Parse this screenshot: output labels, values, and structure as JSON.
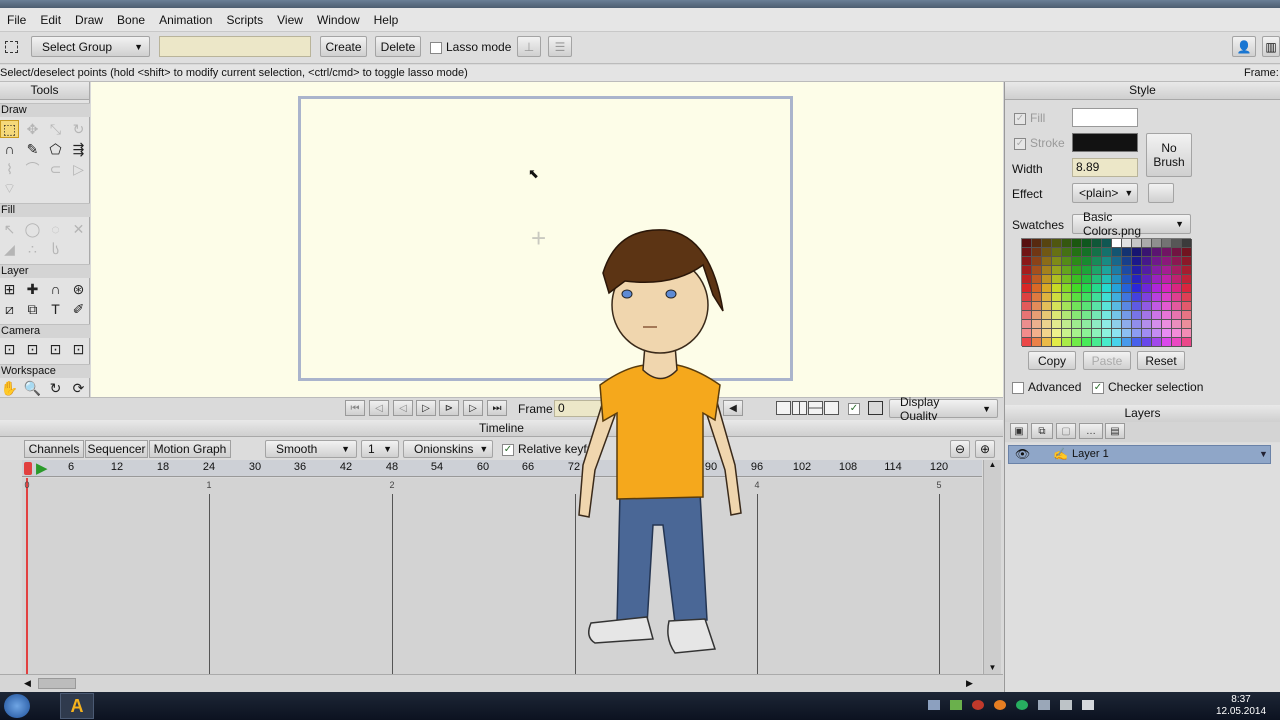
{
  "menu": [
    "File",
    "Edit",
    "Draw",
    "Bone",
    "Animation",
    "Scripts",
    "View",
    "Window",
    "Help"
  ],
  "toolbar": {
    "select_group": "Select Group",
    "create": "Create",
    "delete": "Delete",
    "lasso": "Lasso mode"
  },
  "status": {
    "hint": "Select/deselect points (hold <shift> to modify current selection, <ctrl/cmd> to toggle lasso mode)",
    "frame_label": "Frame:"
  },
  "tools": {
    "title": "Tools",
    "sections": [
      "Draw",
      "Fill",
      "Layer",
      "Camera",
      "Workspace"
    ]
  },
  "playbar": {
    "frame_label": "Frame",
    "frame_value": "0",
    "quality": "Display Quality"
  },
  "timeline": {
    "title": "Timeline",
    "tabs": [
      "Channels",
      "Sequencer",
      "Motion Graph"
    ],
    "interp": "Smooth",
    "step": "1",
    "onion": "Onionskins",
    "relative": "Relative keyfra",
    "ticks": [
      "6",
      "12",
      "18",
      "24",
      "30",
      "36",
      "42",
      "48",
      "54",
      "60",
      "66",
      "72",
      "90",
      "96",
      "102",
      "108",
      "114",
      "120"
    ],
    "beats": [
      "0",
      "1",
      "2",
      "4",
      "5"
    ]
  },
  "style": {
    "title": "Style",
    "fill": "Fill",
    "stroke": "Stroke",
    "width_label": "Width",
    "width_value": "8.89",
    "no_brush": "No Brush",
    "effect_label": "Effect",
    "effect_value": "<plain>",
    "swatches_label": "Swatches",
    "swatches_value": "Basic Colors.png",
    "copy": "Copy",
    "paste": "Paste",
    "reset": "Reset",
    "advanced": "Advanced",
    "checker": "Checker selection"
  },
  "layers": {
    "title": "Layers",
    "items": [
      "Layer 1"
    ]
  },
  "clock": {
    "time": "8:37",
    "date": "12.05.2014"
  },
  "colors": {
    "canvas": "#fdfde8",
    "shirt": "#f5a81c",
    "jeans": "#4a6796",
    "hair": "#5c3414",
    "skin": "#f0d6ae",
    "selected_layer": "#8fa6c8"
  }
}
